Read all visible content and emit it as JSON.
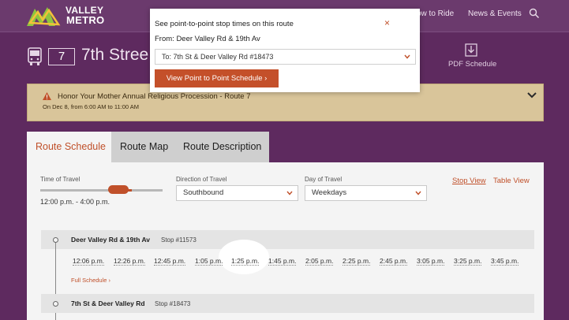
{
  "header": {
    "logo_line1": "VALLEY",
    "logo_line2": "METRO",
    "nav": [
      {
        "label": "ow to Ride"
      },
      {
        "label": "News & Events"
      }
    ],
    "search_icon": "search-icon"
  },
  "route": {
    "number": "7",
    "name": "7th Stree",
    "pdf_label": "PDF Schedule"
  },
  "alert": {
    "title": "Honor Your Mother Annual Religious Procession - Route 7",
    "date": "On Dec 8, from 6:00 AM to 11:00 AM"
  },
  "tabs": [
    {
      "label": "Route Schedule"
    },
    {
      "label": "Route Map"
    },
    {
      "label": "Route Description"
    }
  ],
  "filters": {
    "time_label": "Time of Travel",
    "time_value": "12:00 p.m. - 4:00 p.m.",
    "time_range_start": 0.58,
    "time_range_end": 0.75,
    "direction_label": "Direction of Travel",
    "direction_value": "Southbound",
    "day_label": "Day of Travel",
    "day_value": "Weekdays",
    "stop_view": "Stop View",
    "table_view": "Table View"
  },
  "schedule": {
    "stops": [
      {
        "name": "Deer Valley Rd & 19th Av",
        "id": "Stop #11573"
      },
      {
        "name": "7th St & Deer Valley Rd",
        "id": "Stop #18473"
      }
    ],
    "times": [
      "12:06 p.m.",
      "12:26 p.m.",
      "12:45 p.m.",
      "1:05 p.m.",
      "1:25 p.m.",
      "1:45 p.m.",
      "2:05 p.m.",
      "2:25 p.m.",
      "2:45 p.m.",
      "3:05 p.m.",
      "3:25 p.m.",
      "3:45 p.m."
    ],
    "full_schedule": "Full Schedule ›"
  },
  "modal": {
    "title": "See point-to-point stop times on this route",
    "close": "×",
    "from": "From: Deer Valley Rd & 19th Av",
    "to_value": "To: 7th St & Deer Valley Rd #18473",
    "button": "View Point to Point Schedule ›"
  },
  "colors": {
    "brand_purple": "#5e2a5f",
    "accent": "#c0502a",
    "alert_bg": "#d9c59a"
  }
}
